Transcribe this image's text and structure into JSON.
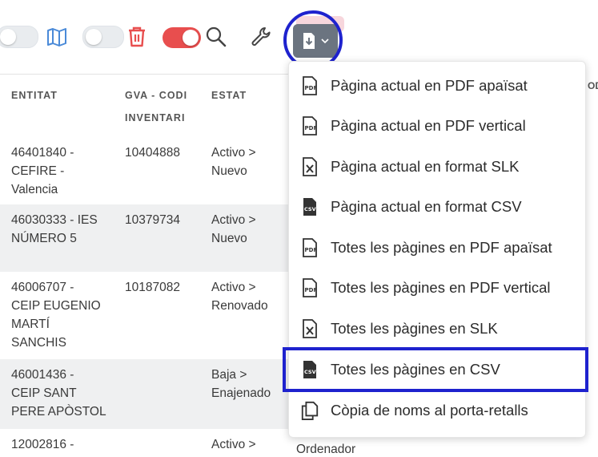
{
  "toolbar": {
    "toggles": [
      {
        "name": "map-toggle",
        "state": "off"
      },
      {
        "name": "delete-toggle",
        "state": "off"
      },
      {
        "name": "filter-toggle",
        "state": "on"
      }
    ],
    "icons": [
      "map-icon",
      "trash-icon",
      "search-icon",
      "wrench-icon",
      "export-icon",
      "chevron-down-icon"
    ],
    "colors": {
      "danger": "#e84e4e",
      "map_blue": "#4a8ad8",
      "export_bg": "#6b7480",
      "highlight": "#1e22ce"
    }
  },
  "table": {
    "headers": [
      {
        "line1": "ENTITAT",
        "line2": ""
      },
      {
        "line1": "GVA - CODI",
        "line2": "INVENTARI"
      },
      {
        "line1": "ESTAT",
        "line2": ""
      }
    ],
    "rows": [
      {
        "entitat": [
          "46401840 -",
          "CEFIRE -",
          "Valencia"
        ],
        "codi": "10404888",
        "estat": [
          "Activo >",
          "Nuevo"
        ]
      },
      {
        "entitat": [
          "46030333 - IES",
          "NÚMERO 5"
        ],
        "codi": "10379734",
        "estat": [
          "Activo >",
          "Nuevo"
        ]
      },
      {
        "entitat": [
          "46006707 -",
          "CEIP EUGENIO",
          "MARTÍ",
          "SANCHIS"
        ],
        "codi": "10187082",
        "estat": [
          "Activo >",
          "Renovado"
        ]
      },
      {
        "entitat": [
          "46001436 -",
          "CEIP SANT",
          "PERE APÒSTOL"
        ],
        "codi": "",
        "estat": [
          "Baja >",
          "Enajenado"
        ]
      },
      {
        "entitat": [
          "12002816 -"
        ],
        "codi": "",
        "estat": [
          "Activo >"
        ]
      }
    ],
    "peek_header": "OD",
    "peek_cell": "Ordenador"
  },
  "menu": {
    "items": [
      {
        "label": "Pàgina actual en PDF apaïsat",
        "icon": "pdf-icon"
      },
      {
        "label": "Pàgina actual en PDF vertical",
        "icon": "pdf-icon"
      },
      {
        "label": "Pàgina actual en format SLK",
        "icon": "excel-icon"
      },
      {
        "label": "Pàgina actual en format CSV",
        "icon": "csv-icon"
      },
      {
        "label": "Totes les pàgines en PDF apaïsat",
        "icon": "pdf-icon"
      },
      {
        "label": "Totes les pàgines en PDF vertical",
        "icon": "pdf-icon"
      },
      {
        "label": "Totes les pàgines en SLK",
        "icon": "excel-icon"
      },
      {
        "label": "Totes les pàgines en CSV",
        "icon": "csv-icon"
      },
      {
        "label": "Còpia de noms al porta-retalls",
        "icon": "copy-icon"
      }
    ]
  }
}
